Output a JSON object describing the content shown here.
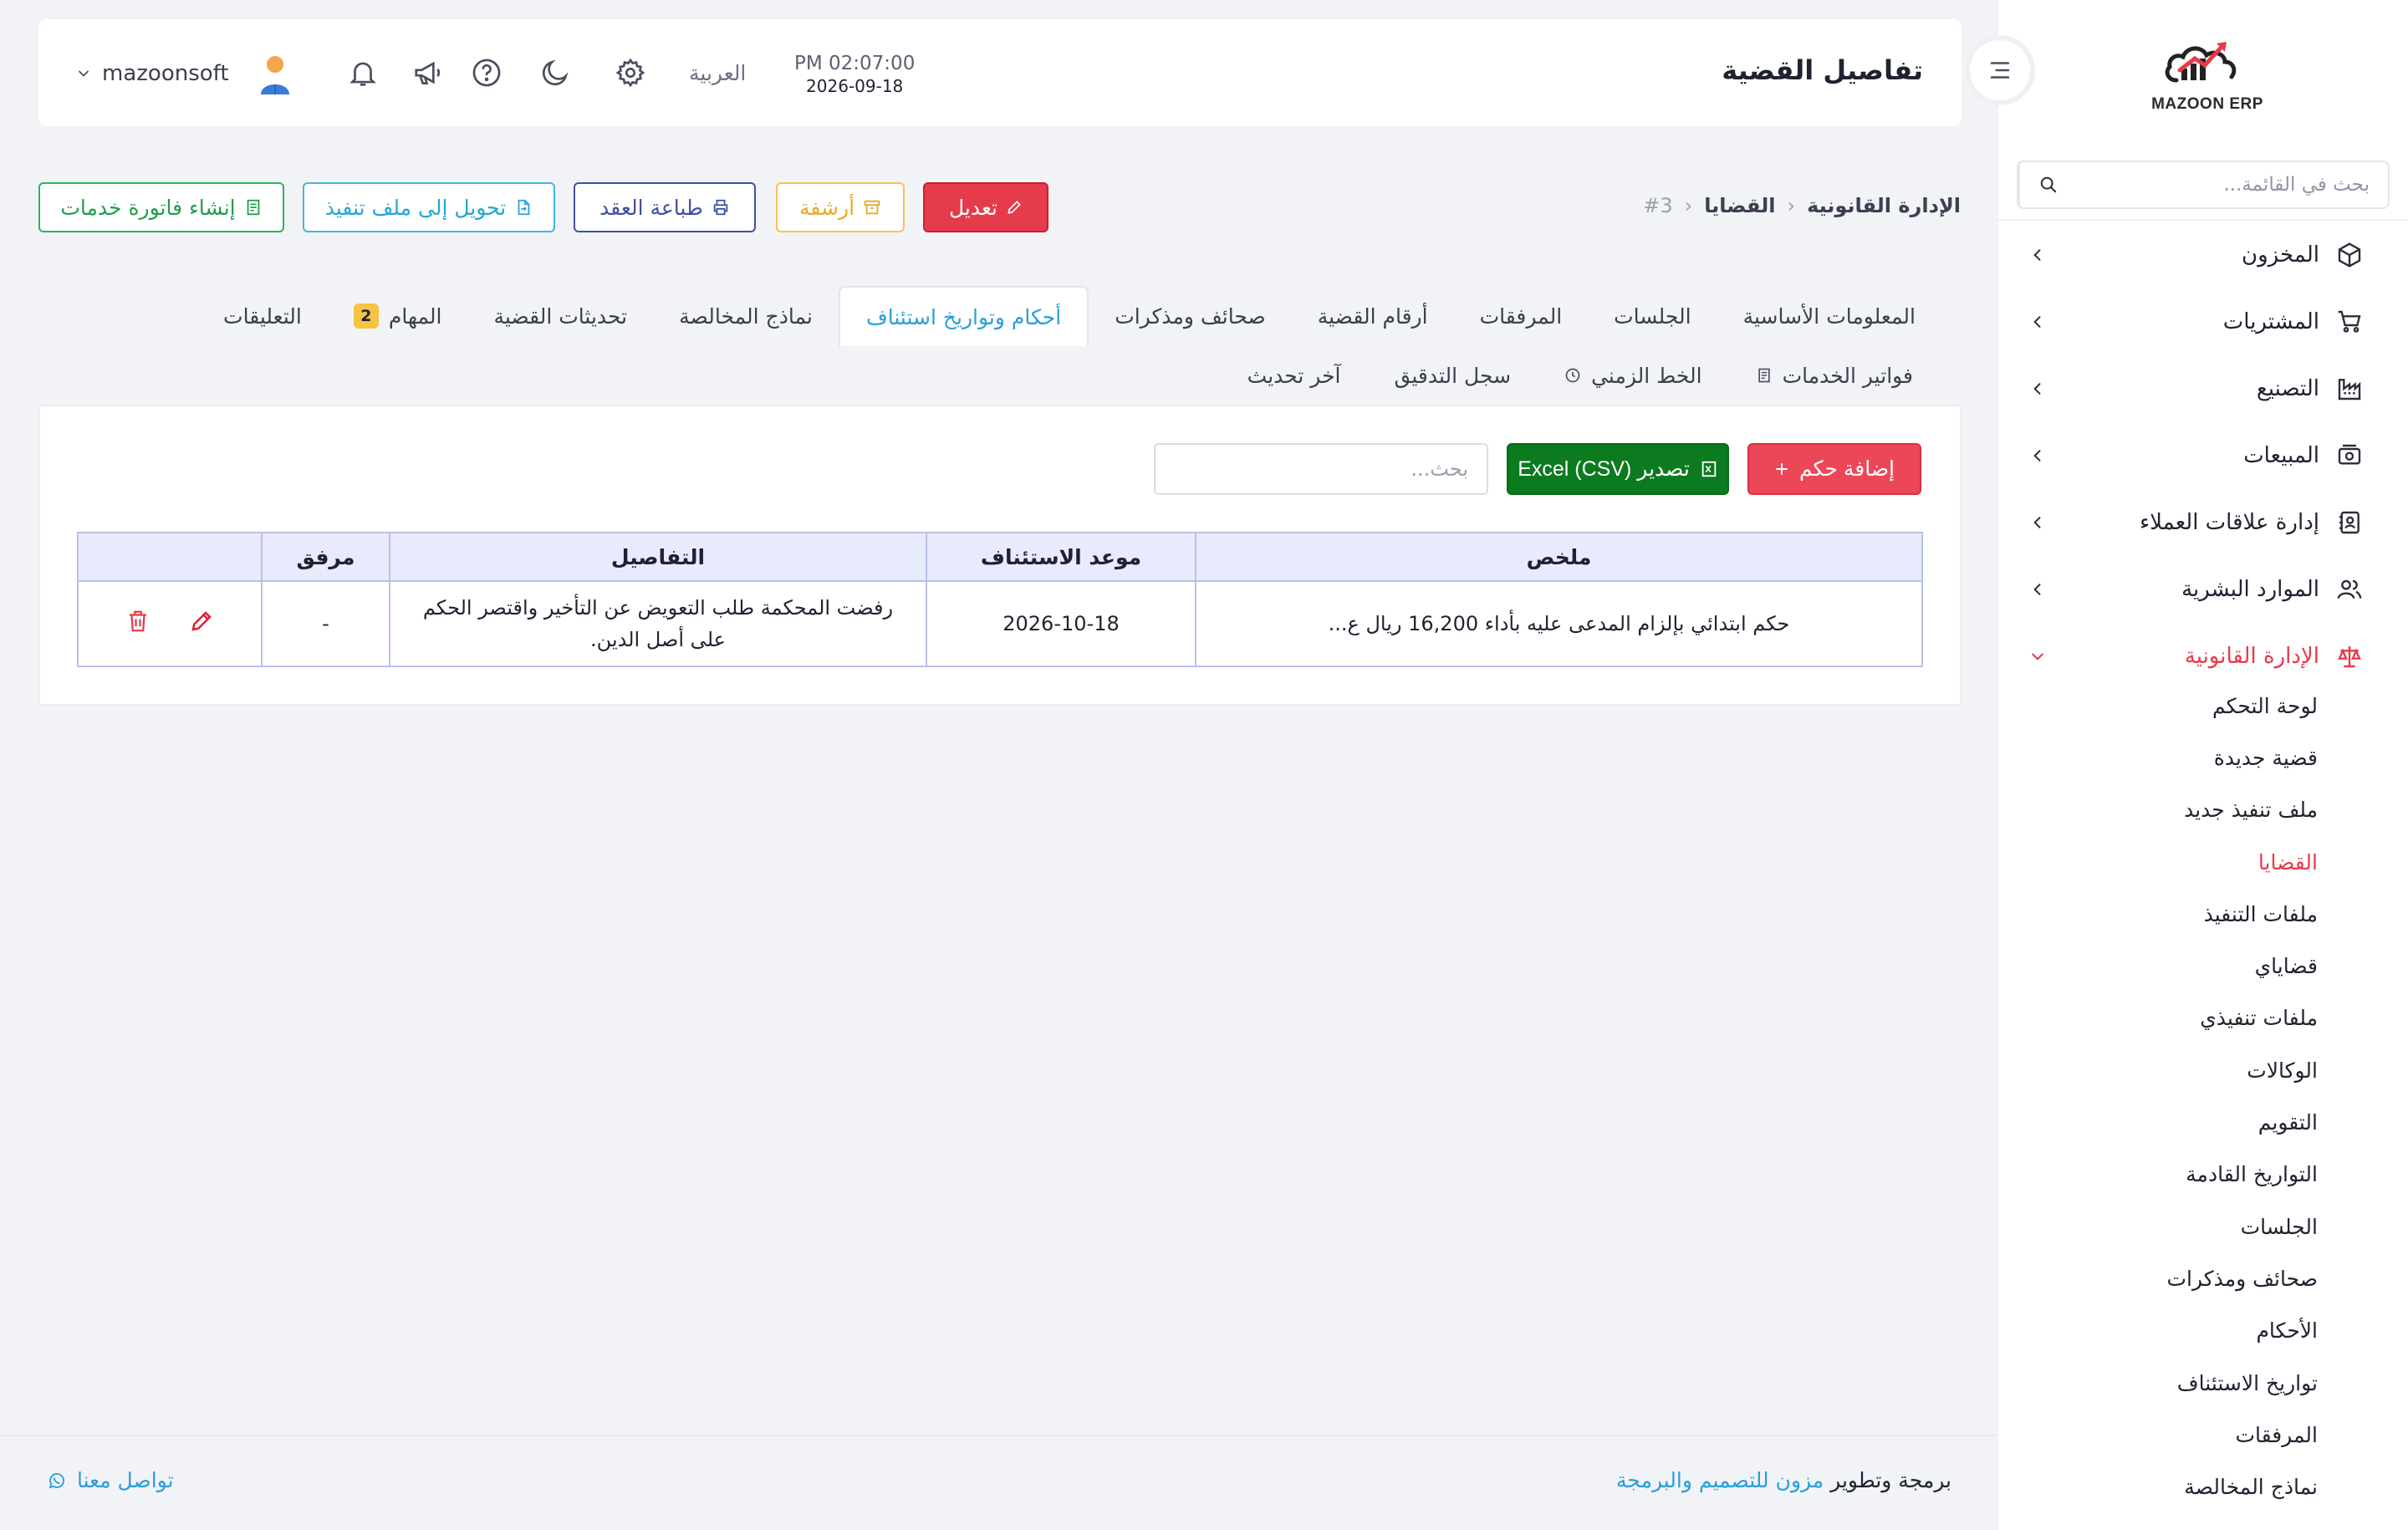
{
  "header": {
    "page_title": "تفاصيل القضية",
    "time": "PM 02:07:00",
    "date": "2026-09-18",
    "language": "العربية",
    "username": "mazoonsoft"
  },
  "logo": {
    "text": "MAZOON ERP"
  },
  "sidebar": {
    "search_placeholder": "بحث في القائمة...",
    "items": [
      {
        "label": "المخزون",
        "icon": "box-icon"
      },
      {
        "label": "المشتريات",
        "icon": "cart-icon"
      },
      {
        "label": "التصنيع",
        "icon": "factory-icon"
      },
      {
        "label": "المبيعات",
        "icon": "cash-icon"
      },
      {
        "label": "إدارة علاقات العملاء",
        "icon": "contacts-icon"
      },
      {
        "label": "الموارد البشرية",
        "icon": "users-icon"
      },
      {
        "label": "الإدارة القانونية",
        "icon": "scale-icon",
        "active": true
      }
    ],
    "subitems": [
      "لوحة التحكم",
      "قضية جديدة",
      "ملف تنفيذ جديد",
      "القضايا",
      "ملفات التنفيذ",
      "قضاياي",
      "ملفات تنفيذي",
      "الوكالات",
      "التقويم",
      "التواريخ القادمة",
      "الجلسات",
      "صحائف ومذكرات",
      "الأحكام",
      "تواريخ الاستئناف",
      "المرفقات",
      "نماذج المخالصة"
    ],
    "active_subitem": "القضايا"
  },
  "breadcrumb": {
    "root": "الإدارة القانونية",
    "section": "القضايا",
    "current": "#3"
  },
  "actions": {
    "edit": "تعديل",
    "archive": "أرشفة",
    "print": "طباعة العقد",
    "convert": "تحويل إلى ملف تنفيذ",
    "invoice": "إنشاء فاتورة خدمات"
  },
  "tabs": {
    "row1": [
      "المعلومات الأساسية",
      "الجلسات",
      "المرفقات",
      "أرقام القضية",
      "صحائف ومذكرات",
      "أحكام وتواريخ استئناف",
      "نماذج المخالصة",
      "تحديثات القضية",
      "المهام",
      "التعليقات"
    ],
    "active": "أحكام وتواريخ استئناف",
    "tasks_badge": "2",
    "row2": [
      "فواتير الخدمات",
      "الخط الزمني",
      "سجل التدقيق",
      "آخر تحديث"
    ]
  },
  "panel": {
    "add_button": "إضافة حكم",
    "export_button": "Excel (CSV) تصدير",
    "search_placeholder": "بحث..."
  },
  "table": {
    "headers": [
      "ملخص",
      "موعد الاستئناف",
      "التفاصيل",
      "مرفق",
      ""
    ],
    "rows": [
      {
        "summary": "حكم ابتدائي بإلزام المدعى عليه بأداء 16,200 ريال ع...",
        "appeal_date": "2026-10-18",
        "details": "رفضت المحكمة طلب التعويض عن التأخير واقتصر الحكم على أصل الدين.",
        "attachment": "-"
      }
    ]
  },
  "footer": {
    "contact": "تواصل معنا",
    "credit_prefix": "برمجة وتطوير",
    "credit_link": "مزون للتصميم والبرمجة"
  },
  "colors": {
    "primary_red": "#e63b4a",
    "accent_blue": "#2a9fd8",
    "export_green": "#0c7a1e"
  }
}
